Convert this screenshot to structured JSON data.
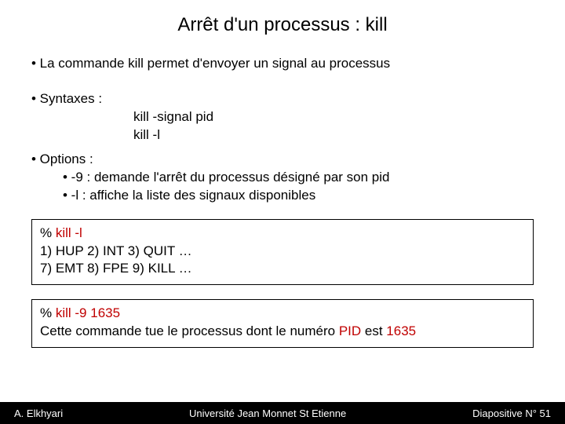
{
  "title": "Arrêt d'un processus : kill",
  "bullet1": "• La commande kill permet d'envoyer un signal au processus",
  "bullet2": "• Syntaxes :",
  "syntax1": "kill   -signal    pid",
  "syntax2": "kill   -l",
  "bullet3": "• Options :",
  "opt1": "• -9  :  demande l'arrêt du processus désigné par son pid",
  "opt2": "• -l   : affiche la liste des signaux disponibles",
  "box1": {
    "line1a": "% ",
    "line1b": "kill   -l",
    "line2": "1) HUP   2) INT  3) QUIT …",
    "line3": "7) EMT   8) FPE  9) KILL …"
  },
  "box2": {
    "line1a": "% ",
    "line1b": "kill   -9   1635",
    "line2a": "Cette commande tue le processus dont le numéro ",
    "line2b": "PID",
    "line2c": " est ",
    "line2d": "1635"
  },
  "footer": {
    "left": "A. Elkhyari",
    "center": "Université Jean Monnet St Etienne",
    "right": "Diapositive N° 51"
  }
}
